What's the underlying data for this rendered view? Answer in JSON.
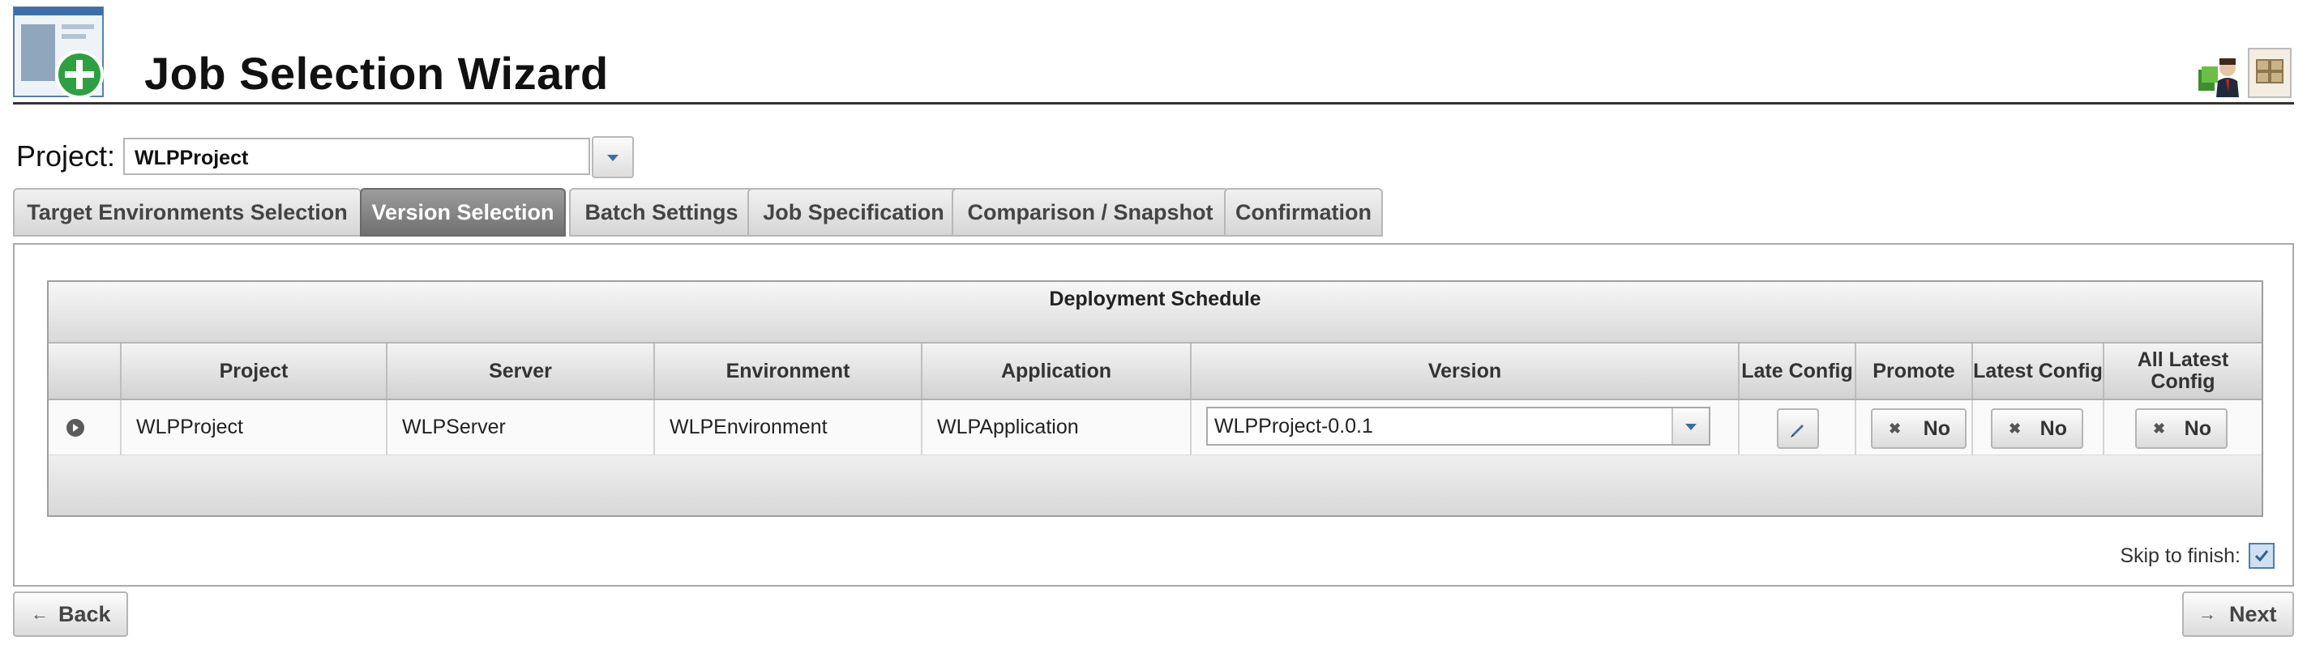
{
  "header": {
    "title": "Job Selection Wizard"
  },
  "project": {
    "label": "Project:",
    "value": "WLPProject"
  },
  "tabs": [
    {
      "label": "Target Environments Selection",
      "active": false
    },
    {
      "label": "Version Selection",
      "active": true
    },
    {
      "label": "Batch Settings",
      "active": false
    },
    {
      "label": "Job Specification",
      "active": false
    },
    {
      "label": "Comparison / Snapshot",
      "active": false
    },
    {
      "label": "Confirmation",
      "active": false
    }
  ],
  "grid": {
    "caption": "Deployment Schedule",
    "columns": [
      "Project",
      "Server",
      "Environment",
      "Application",
      "Version",
      "Late Config",
      "Promote",
      "Latest Config",
      "All Latest Config"
    ],
    "rows": [
      {
        "project": "WLPProject",
        "server": "WLPServer",
        "environment": "WLPEnvironment",
        "application": "WLPApplication",
        "version": "WLPProject-0.0.1",
        "promote": "No",
        "latest_config": "No",
        "all_latest_config": "No"
      }
    ]
  },
  "skip_to_finish": {
    "label": "Skip to finish:",
    "checked": true
  },
  "nav": {
    "back_label": "Back",
    "next_label": "Next"
  },
  "icons": {
    "app_logo": "wizard-add-icon",
    "user_icons": [
      "user-icon",
      "package-icon"
    ],
    "row_expander": "expand-icon",
    "late_config": "pencil-icon",
    "no_buttons": "x-icon"
  },
  "colors": {
    "active_tab": "#7f7f7f",
    "check": "#4b7fb5",
    "logo_plus": "#2ea043"
  }
}
